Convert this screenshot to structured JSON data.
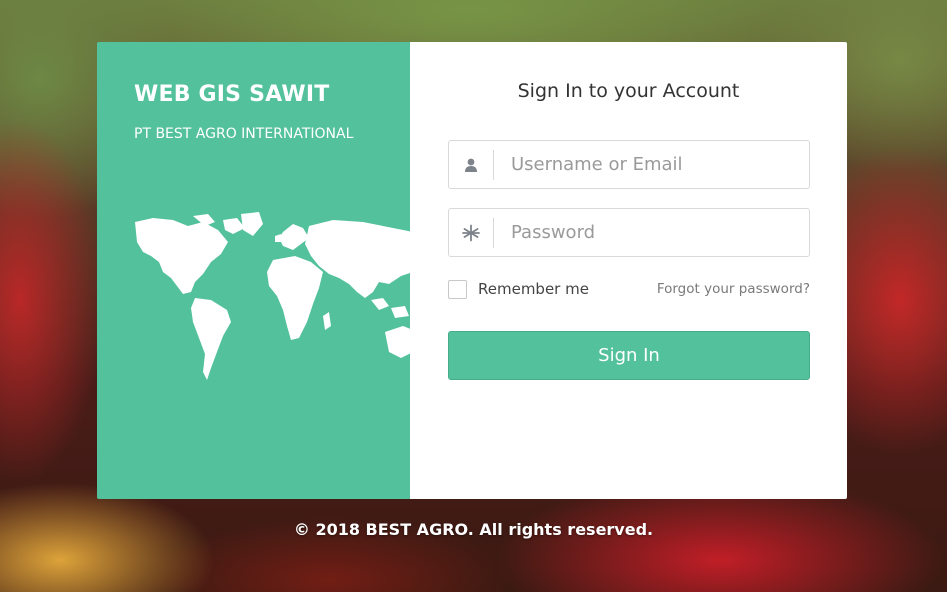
{
  "brand": {
    "title": "WEB GIS SAWIT",
    "subtitle": "PT BEST AGRO INTERNATIONAL"
  },
  "form": {
    "title": "Sign In to your Account",
    "username_placeholder": "Username or Email",
    "password_placeholder": "Password",
    "remember_label": "Remember me",
    "forgot_label": "Forgot your password?",
    "submit_label": "Sign In"
  },
  "icons": {
    "username": "user-icon",
    "password": "asterisk-icon",
    "map": "world-map-icon"
  },
  "footer": {
    "copyright": "© 2018 BEST AGRO. All rights reserved."
  },
  "colors": {
    "accent": "#53c19b",
    "panel": "#ffffff"
  }
}
